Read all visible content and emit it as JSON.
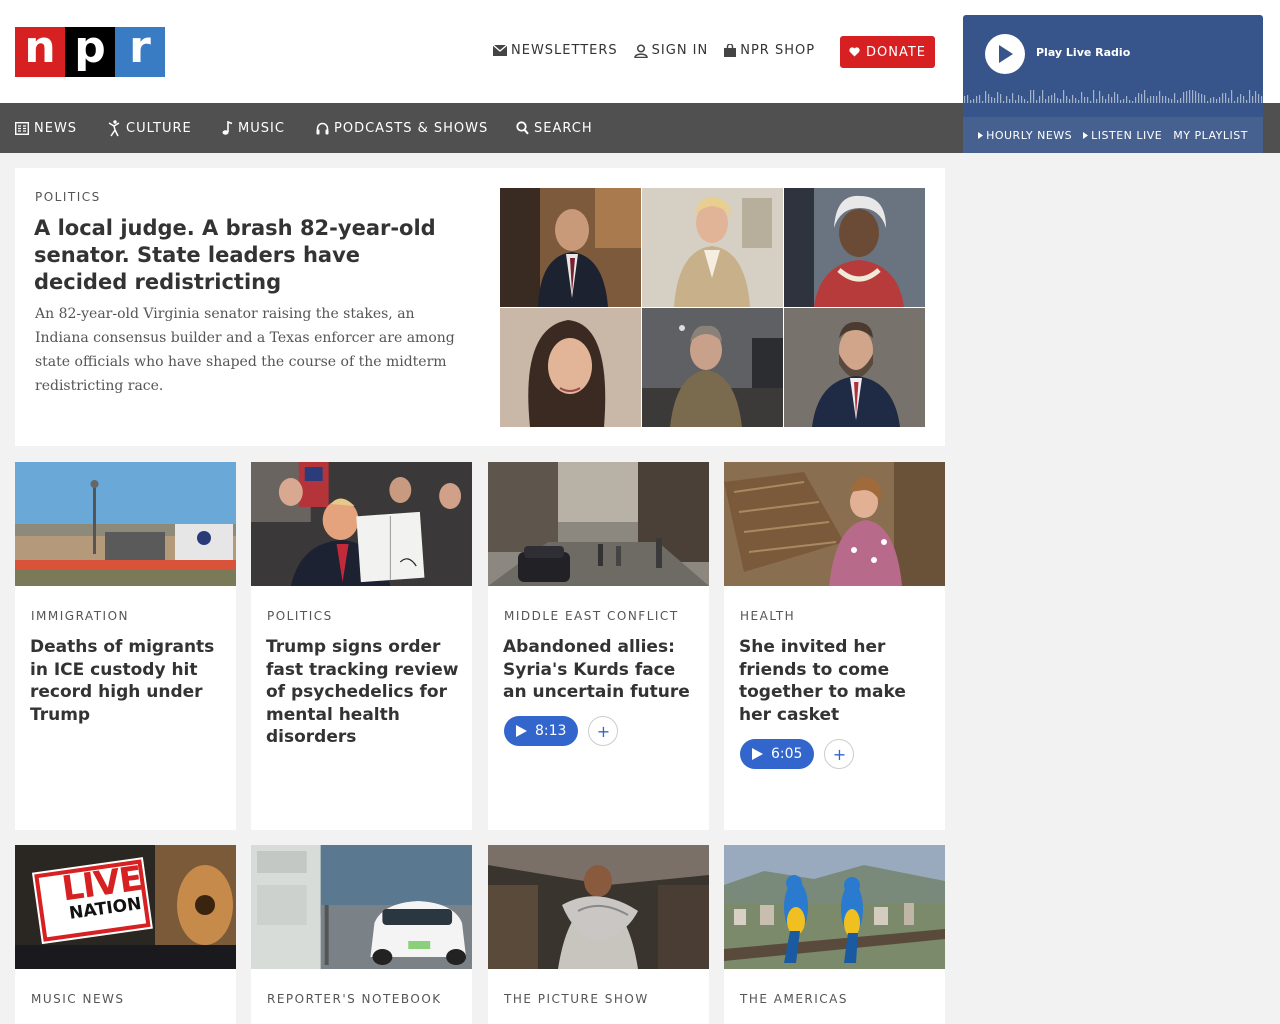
{
  "header": {
    "logo": [
      "n",
      "p",
      "r"
    ],
    "links": [
      {
        "icon": "envelope-icon",
        "label": "NEWSLETTERS"
      },
      {
        "icon": "user-icon",
        "label": "SIGN IN"
      },
      {
        "icon": "bag-icon",
        "label": "NPR SHOP"
      }
    ],
    "donate_label": "DONATE",
    "colors": {
      "red": "#d62021",
      "black": "#000000",
      "blue": "#3a7cc3"
    }
  },
  "nav": {
    "items": [
      {
        "icon": "newspaper-icon",
        "label": "NEWS"
      },
      {
        "icon": "dancer-icon",
        "label": "CULTURE"
      },
      {
        "icon": "music-note-icon",
        "label": "MUSIC"
      },
      {
        "icon": "headphones-icon",
        "label": "PODCASTS & SHOWS"
      },
      {
        "icon": "search-icon",
        "label": "SEARCH"
      }
    ]
  },
  "player": {
    "title": "Play Live Radio",
    "links": [
      "HOURLY NEWS",
      "LISTEN LIVE",
      "MY PLAYLIST"
    ],
    "color": "#37558a"
  },
  "feature": {
    "kicker": "POLITICS",
    "title": "A local judge. A brash 82-year-old senator. State leaders have decided redistricting",
    "teaser": "An 82-year-old Virginia senator raising the stakes, an Indiana consensus builder and a Texas enforcer are among state officials who have shaped the course of the midterm redistricting race."
  },
  "cards_row1": [
    {
      "kicker": "IMMIGRATION",
      "title": "Deaths of migrants in ICE custody hit record high under Trump"
    },
    {
      "kicker": "POLITICS",
      "title": "Trump signs order fast tracking review of psychedelics for mental health disorders"
    },
    {
      "kicker": "MIDDLE EAST CONFLICT",
      "title": "Abandoned allies: Syria's Kurds face an uncertain future",
      "duration": "8:13"
    },
    {
      "kicker": "HEALTH",
      "title": "She invited her friends to come together to make her casket",
      "duration": "6:05"
    }
  ],
  "cards_row2": [
    {
      "kicker": "MUSIC NEWS",
      "logo_text": [
        "LIVE",
        "NATION"
      ]
    },
    {
      "kicker": "REPORTER'S NOTEBOOK"
    },
    {
      "kicker": "THE PICTURE SHOW"
    },
    {
      "kicker": "THE AMERICAS"
    }
  ],
  "audio_color": "#3366cc"
}
